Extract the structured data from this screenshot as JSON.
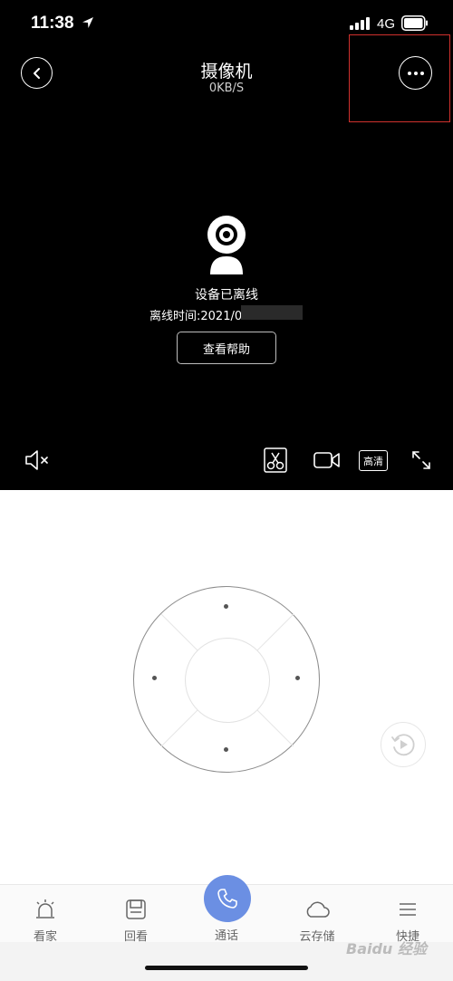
{
  "status_bar": {
    "time": "11:38",
    "network": "4G"
  },
  "header": {
    "title": "摄像机",
    "speed": "0KB/S"
  },
  "offline": {
    "status": "设备已离线",
    "time_label": "离线时间:2021/0",
    "help_button": "查看帮助"
  },
  "toolbar": {
    "quality_label": "高清"
  },
  "tabs": [
    {
      "label": "看家",
      "icon": "alarm-icon"
    },
    {
      "label": "回看",
      "icon": "playback-icon"
    },
    {
      "label": "通话",
      "icon": "phone-icon"
    },
    {
      "label": "云存储",
      "icon": "cloud-icon"
    },
    {
      "label": "快捷",
      "icon": "menu-icon"
    }
  ],
  "watermark": "Baidu 经验",
  "colors": {
    "accent": "#6b8fe3",
    "highlight": "#d0312d",
    "video_bg": "#000000"
  }
}
